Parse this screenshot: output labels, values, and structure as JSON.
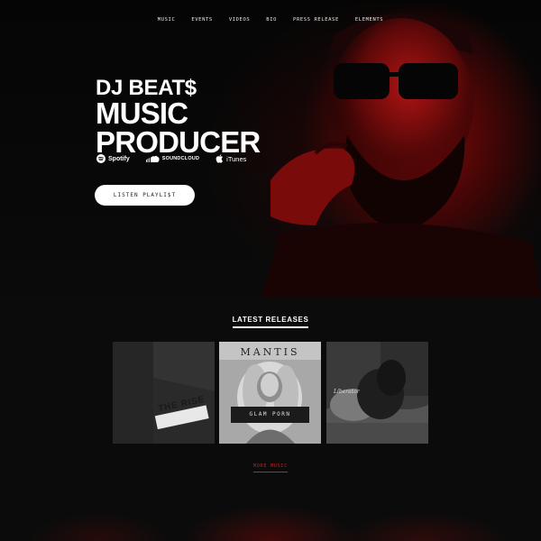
{
  "nav": {
    "items": [
      {
        "label": "MUSIC"
      },
      {
        "label": "EVENTS"
      },
      {
        "label": "VIDEOS"
      },
      {
        "label": "BIO"
      },
      {
        "label": "PRESS RELEASE"
      },
      {
        "label": "ELEMENTS"
      }
    ]
  },
  "hero": {
    "dj_name": "DJ BEAT$",
    "title_line1": "MUSIC",
    "title_line2": "PRODUCER",
    "services": [
      {
        "label": "Spotify",
        "icon": "spotify-icon"
      },
      {
        "label": "SOUNDCLOUD",
        "icon": "soundcloud-icon"
      },
      {
        "label": "iTunes",
        "icon": "apple-icon"
      }
    ],
    "cta_label": "LISTEN PLAYLI$T"
  },
  "releases": {
    "heading": "LATEST RELEASES",
    "items": [
      {
        "cover_text": "THE RISE"
      },
      {
        "artist": "MANTIS",
        "cover_text": "GLAM PORN"
      },
      {
        "cover_text": "Liberator"
      }
    ],
    "more_label": "MORE MUSIC"
  },
  "colors": {
    "accent": "#c62222",
    "background": "#0b0b0b",
    "hero_red": "#8c0a0a",
    "text": "#ffffff"
  }
}
